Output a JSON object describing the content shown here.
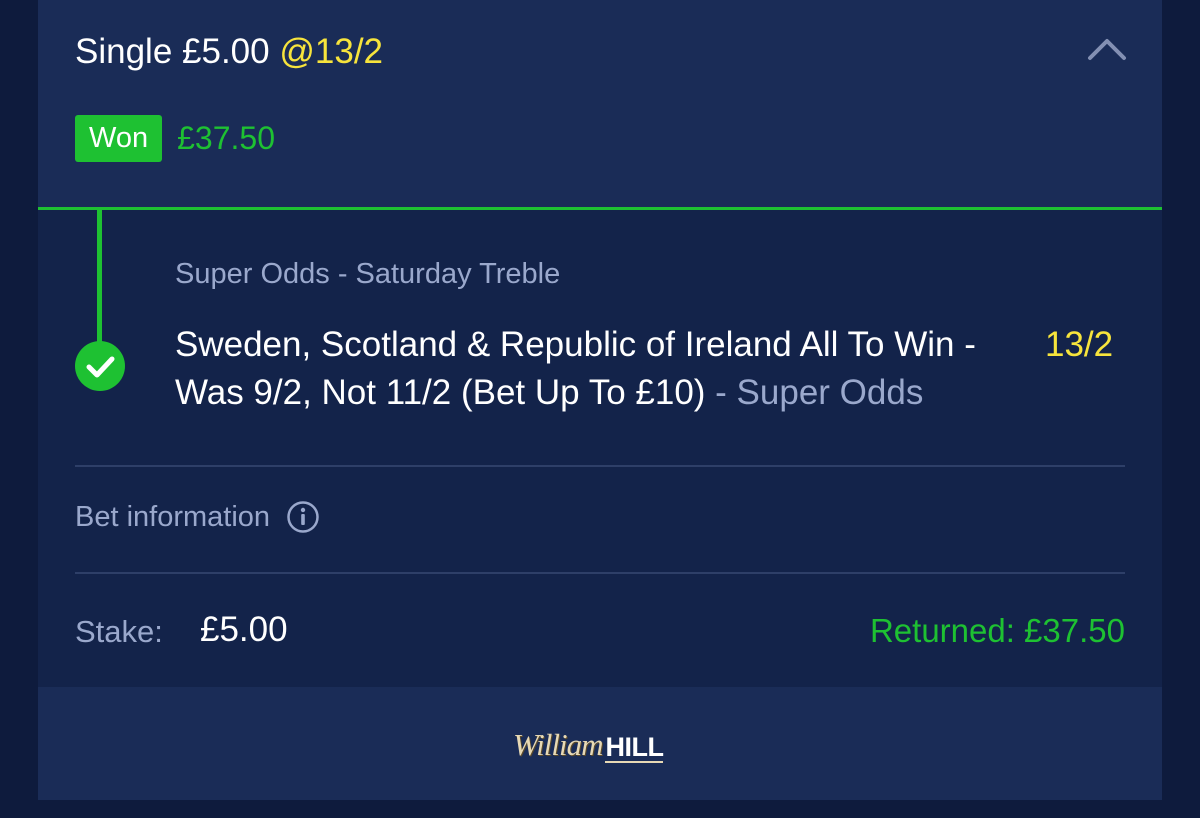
{
  "bet": {
    "type_label": "Single",
    "stake_header": "£5.00",
    "odds_header": "@13/2",
    "status": "Won",
    "won_amount": "£37.50"
  },
  "selection": {
    "market": "Super Odds - Saturday Treble",
    "description": "Sweden, Scotland & Republic of Ireland All To Win - Was 9/2, Not 11/2 (Bet Up To £10)",
    "suffix": " - Super Odds",
    "odds": "13/2"
  },
  "info": {
    "label": "Bet information"
  },
  "summary": {
    "stake_label": "Stake:",
    "stake_value": "£5.00",
    "returned": "Returned: £37.50"
  },
  "footer": {
    "logo_script": "William",
    "logo_block": "HILL"
  },
  "colors": {
    "background": "#0e1b3d",
    "card": "#1a2c57",
    "body": "#13234a",
    "win_green": "#1ec132",
    "odds_yellow": "#f7e43c",
    "muted_text": "#9aa8cc"
  },
  "icons": {
    "collapse": "chevron-up-icon",
    "status": "checkmark-circle-icon",
    "info": "info-circle-icon"
  }
}
